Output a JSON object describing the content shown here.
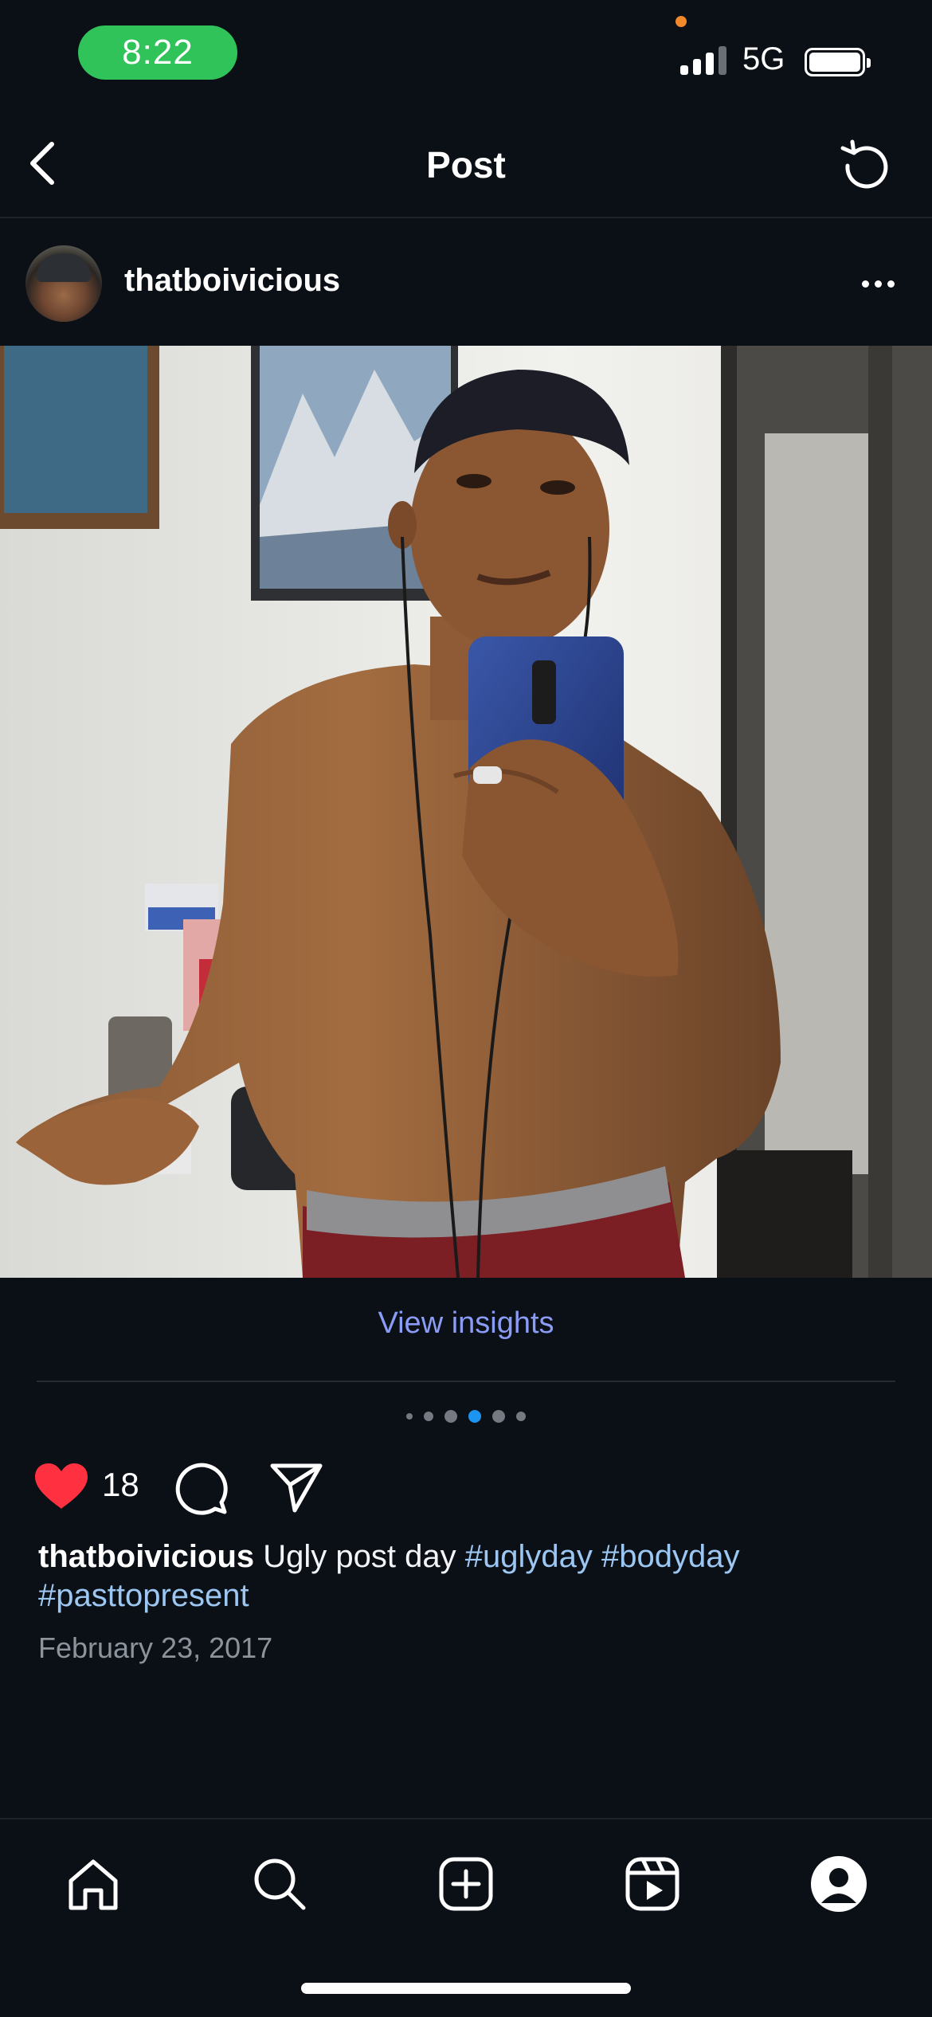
{
  "status_bar": {
    "time": "8:22",
    "network": "5G",
    "signal_bars_active": 3,
    "signal_bars_total": 4,
    "battery_level": 1.0,
    "time_pill_color": "#30c35a"
  },
  "header": {
    "title": "Post",
    "back_icon": "chevron-left-icon",
    "refresh_icon": "refresh-icon"
  },
  "post": {
    "username": "thatboivicious",
    "more_icon": "more-horizontal-icon",
    "insights_label": "View insights",
    "carousel": {
      "count": 6,
      "active_index": 3
    },
    "likes": "18",
    "liked": true,
    "like_color": "#ff3040",
    "caption": {
      "username": "thatboivicious",
      "text": " Ugly post day ",
      "tags": [
        "#uglyday",
        "#bodyday",
        "#pasttopresent"
      ]
    },
    "date": "February 23, 2017"
  },
  "bottom_nav": {
    "items": [
      {
        "icon": "home-icon"
      },
      {
        "icon": "search-icon"
      },
      {
        "icon": "create-post-icon"
      },
      {
        "icon": "reels-icon"
      },
      {
        "icon": "profile-icon"
      }
    ]
  }
}
